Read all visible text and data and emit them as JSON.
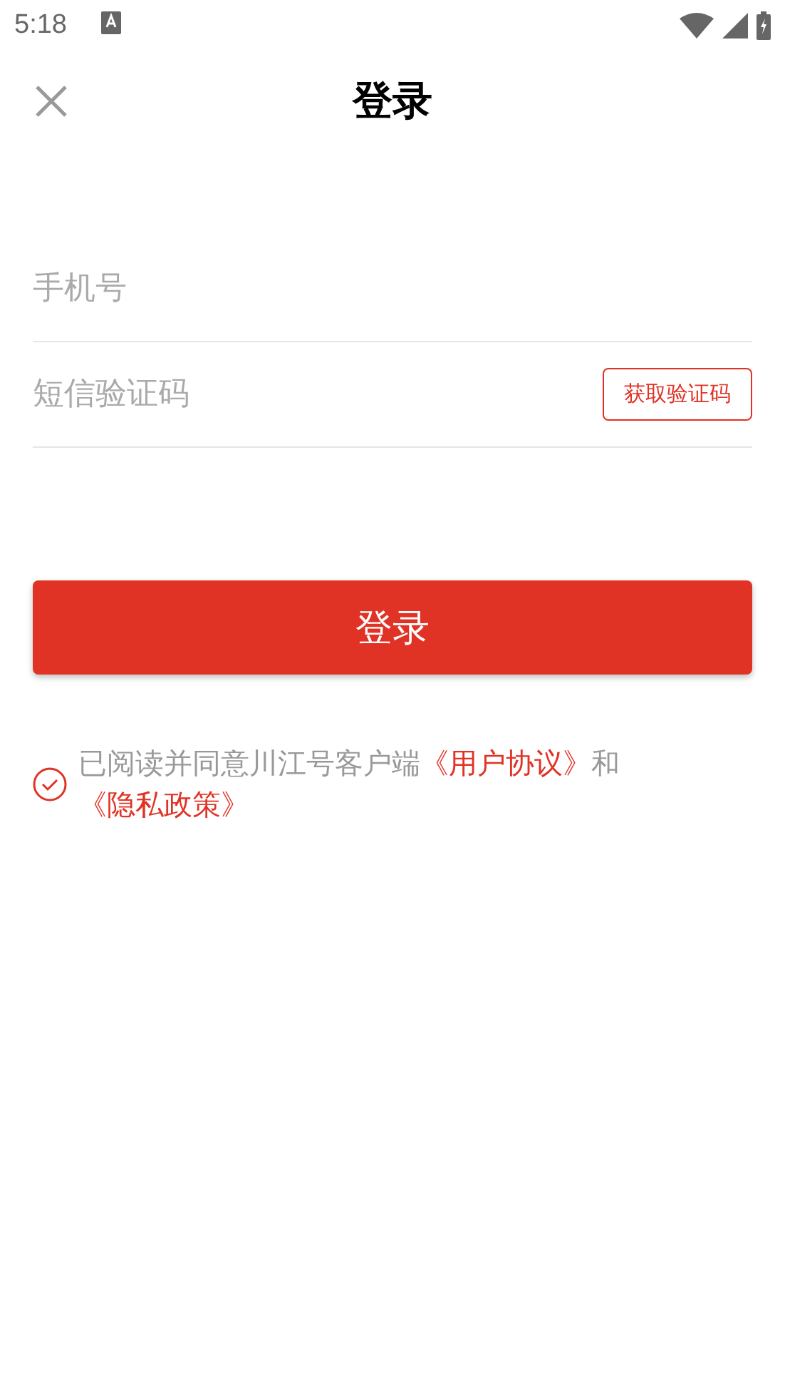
{
  "status_bar": {
    "time": "5:18"
  },
  "header": {
    "title": "登录"
  },
  "phone_field": {
    "placeholder": "手机号"
  },
  "code_field": {
    "placeholder": "短信验证码",
    "button": "获取验证码"
  },
  "login_button": "登录",
  "agreement": {
    "checked": true,
    "parts": [
      {
        "kind": "text",
        "text": "已阅读并同意川江号客户端"
      },
      {
        "kind": "link",
        "text": "《用户协议》"
      },
      {
        "kind": "text",
        "text": "和"
      },
      {
        "kind": "link",
        "text": "《隐私政策》"
      }
    ]
  }
}
